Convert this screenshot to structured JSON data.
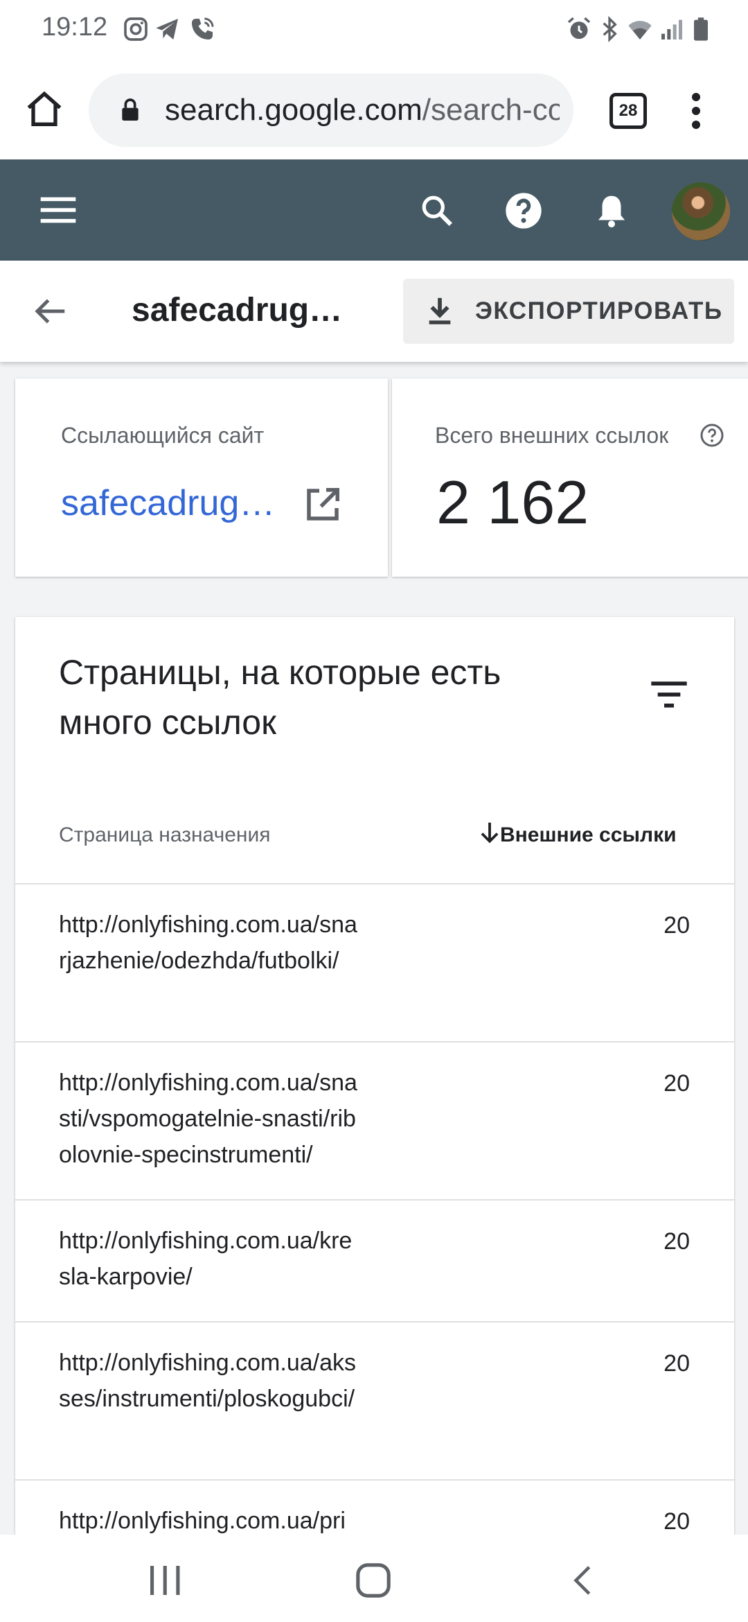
{
  "status_bar": {
    "time": "19:12",
    "left_icons": [
      "instagram-icon",
      "telegram-icon",
      "phone-call-icon"
    ],
    "right_icons": [
      "alarm-icon",
      "bluetooth-icon",
      "wifi-icon",
      "signal-icon",
      "battery-icon"
    ]
  },
  "browser": {
    "url_host": "search.google.com",
    "url_path": "/search-console",
    "tabs_count": "28"
  },
  "app_bar": {
    "icons": [
      "menu-icon",
      "search-icon",
      "help-icon",
      "bell-icon"
    ],
    "colors": {
      "background": "#455a64"
    }
  },
  "header": {
    "title": "safecadrug…",
    "export_label": "ЭКСПОРТИРОВАТЬ"
  },
  "summary": {
    "site_label": "Ссылающийся сайт",
    "site_value": "safecadrug…",
    "total_label": "Всего внешних ссылок",
    "total_value": "2 162"
  },
  "table": {
    "title": "Страницы, на которые есть много ссылок",
    "col_page": "Страница назначения",
    "col_links": "Внешние ссылки",
    "rows": [
      {
        "url": "http://onlyfishing.com.ua/snarjazhenie/odezhda/futbolki/",
        "links": "20"
      },
      {
        "url": "http://onlyfishing.com.ua/snasti/vspomogatelnie-snasti/ribolovnie-specinstrumenti/",
        "links": "20"
      },
      {
        "url": "http://onlyfishing.com.ua/kresla-karpovie/",
        "links": "20"
      },
      {
        "url": "http://onlyfishing.com.ua/aksses/instrumenti/ploskogubci/",
        "links": "20"
      },
      {
        "url": "http://onlyfishing.com.ua/pri",
        "links": "20"
      }
    ]
  },
  "colors": {
    "link": "#3367d6",
    "divider": "#e0e0e0"
  }
}
